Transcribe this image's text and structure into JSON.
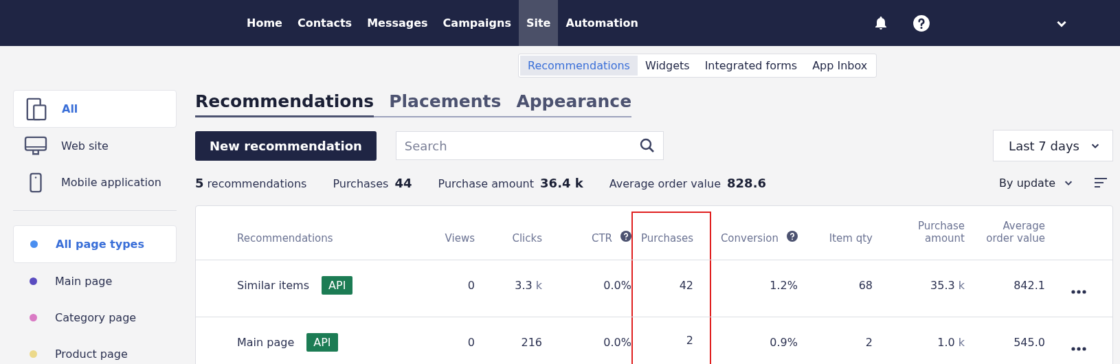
{
  "nav": {
    "items": [
      {
        "label": "Home",
        "selected": false
      },
      {
        "label": "Contacts",
        "selected": false
      },
      {
        "label": "Messages",
        "selected": false
      },
      {
        "label": "Campaigns",
        "selected": false
      },
      {
        "label": "Site",
        "selected": true
      },
      {
        "label": "Automation",
        "selected": false
      }
    ]
  },
  "sub_tabs": [
    {
      "label": "Recommendations",
      "selected": true
    },
    {
      "label": "Widgets",
      "selected": false
    },
    {
      "label": "Integrated forms",
      "selected": false
    },
    {
      "label": "App Inbox",
      "selected": false
    }
  ],
  "sidebar": {
    "channels": [
      {
        "label": "All",
        "kind": "all",
        "selected": true
      },
      {
        "label": "Web site",
        "kind": "desktop",
        "selected": false
      },
      {
        "label": "Mobile application",
        "kind": "mobile",
        "selected": false
      }
    ],
    "page_types": [
      {
        "label": "All page types",
        "color": "#4a8ef0",
        "selected": true
      },
      {
        "label": "Main page",
        "color": "#5a4cc0",
        "selected": false
      },
      {
        "label": "Category page",
        "color": "#d97ac4",
        "selected": false
      },
      {
        "label": "Product page",
        "color": "#ecd98a",
        "selected": false
      }
    ]
  },
  "page_tabs": [
    {
      "label": "Recommendations",
      "selected": true
    },
    {
      "label": "Placements",
      "selected": false
    },
    {
      "label": "Appearance",
      "selected": false
    }
  ],
  "toolbar": {
    "button": "New recommendation",
    "search": {
      "placeholder": "Search"
    },
    "period": "Last 7 days"
  },
  "summary": {
    "count": {
      "value": "5",
      "label": "recommendations"
    },
    "stats": [
      {
        "label": "Purchases",
        "value": "44"
      },
      {
        "label": "Purchase amount",
        "value": "36.4 k"
      },
      {
        "label": "Average order value",
        "value": "828.6"
      }
    ],
    "sort": "By update"
  },
  "table": {
    "columns": [
      {
        "label": "Recommendations",
        "help": false,
        "highlighted": false
      },
      {
        "label": "Views",
        "help": false,
        "highlighted": false
      },
      {
        "label": "Clicks",
        "help": false,
        "highlighted": false
      },
      {
        "label": "CTR",
        "help": true,
        "highlighted": false
      },
      {
        "label": "Purchases",
        "help": false,
        "highlighted": true
      },
      {
        "label": "Conversion",
        "help": true,
        "highlighted": false
      },
      {
        "label": "Item qty",
        "help": false,
        "highlighted": false
      },
      {
        "label": "Purchase amount",
        "help": false,
        "highlighted": false
      },
      {
        "label": "Average order value",
        "help": false,
        "highlighted": false
      }
    ],
    "rows": [
      {
        "cells": [
          {
            "value": "Similar items",
            "badge": "API"
          },
          {
            "value": "0"
          },
          {
            "value": "3.3",
            "unit": "k"
          },
          {
            "value": "0.0%"
          },
          {
            "value": "42"
          },
          {
            "value": "1.2%"
          },
          {
            "value": "68"
          },
          {
            "value": "35.3",
            "unit": "k"
          },
          {
            "value": "842.1"
          }
        ]
      },
      {
        "cells": [
          {
            "value": "Main page",
            "badge": "API"
          },
          {
            "value": "0"
          },
          {
            "value": "216"
          },
          {
            "value": "0.0%"
          },
          {
            "value": "2"
          },
          {
            "value": "0.9%"
          },
          {
            "value": "2"
          },
          {
            "value": "1.0",
            "unit": "k"
          },
          {
            "value": "545.0"
          }
        ]
      }
    ]
  }
}
